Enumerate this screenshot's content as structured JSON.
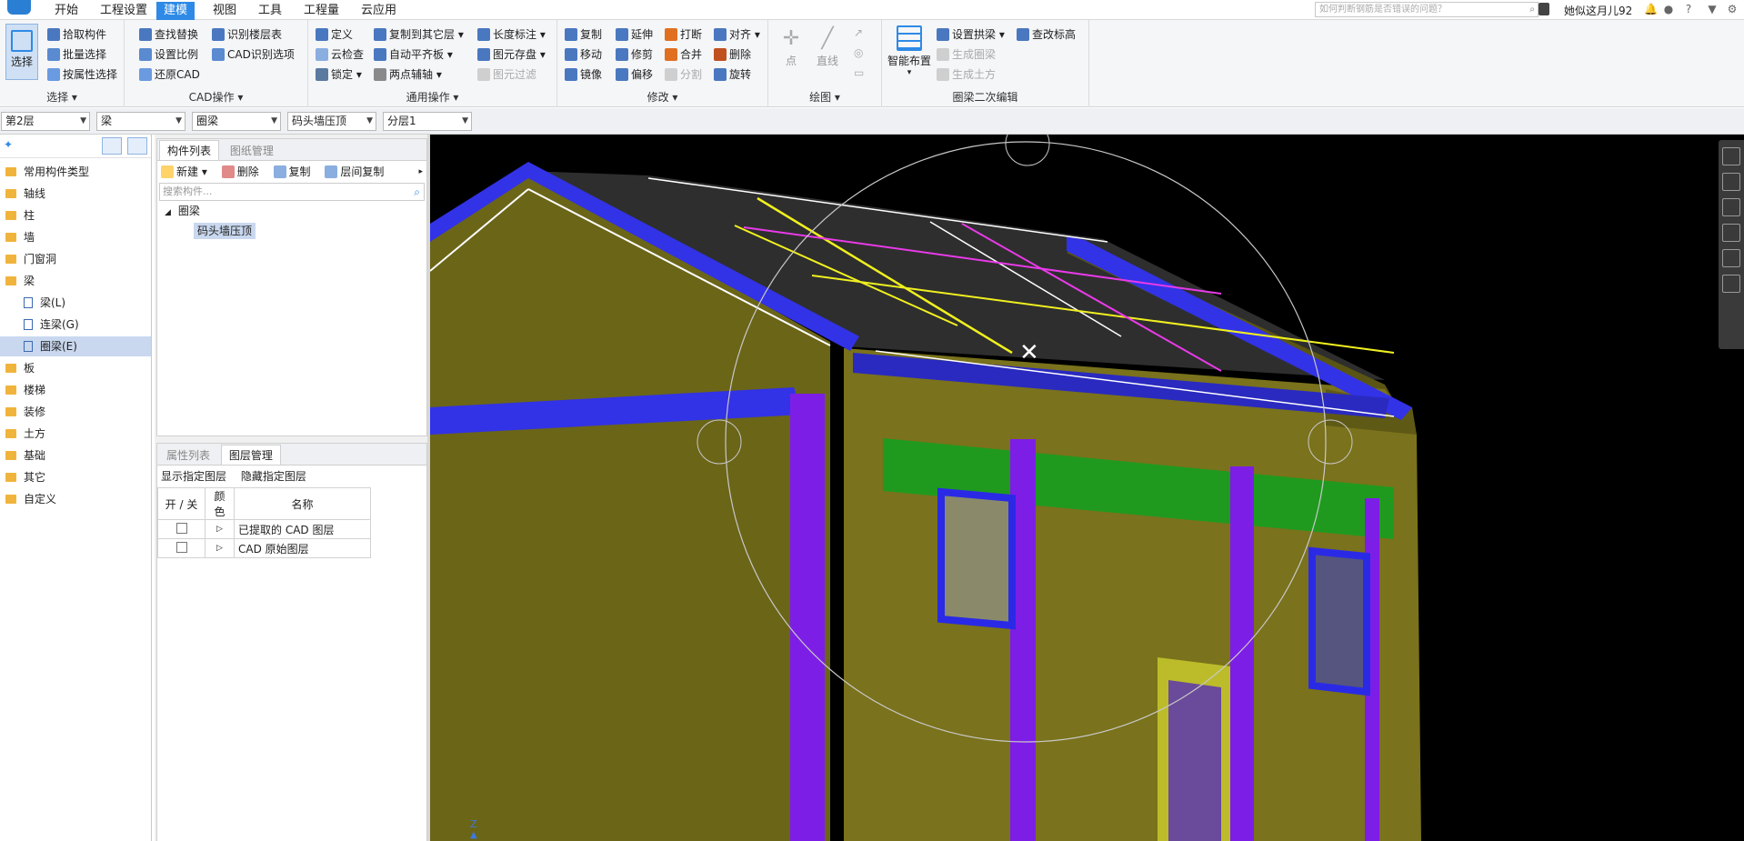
{
  "menubar": {
    "items": [
      "开始",
      "工程设置",
      "建模",
      "视图",
      "工具",
      "工程量",
      "云应用"
    ],
    "active": "建模",
    "search_placeholder": "如何判断钢筋是否错误的问题？",
    "user": "她似这月儿92"
  },
  "ribbon": {
    "select": {
      "title": "选择",
      "big_label": "选择",
      "items": [
        "拾取构件",
        "批量选择",
        "按属性选择"
      ]
    },
    "cad": {
      "title": "CAD操作",
      "items": [
        "查找替换",
        "识别楼层表",
        "设置比例",
        "CAD识别选项",
        "还原CAD"
      ]
    },
    "common": {
      "title": "通用操作",
      "items": [
        "定义",
        "复制到其它层",
        "长度标注",
        "云检查",
        "自动平齐板",
        "图元存盘",
        "锁定",
        "两点辅轴",
        "图元过滤"
      ]
    },
    "modify": {
      "title": "修改",
      "items": [
        "复制",
        "延伸",
        "打断",
        "对齐",
        "移动",
        "修剪",
        "合并",
        "删除",
        "镜像",
        "偏移",
        "分割",
        "旋转"
      ]
    },
    "draw": {
      "title": "绘图",
      "items": [
        "点",
        "直线"
      ]
    },
    "ring": {
      "title": "圈梁二次编辑",
      "big_label": "智能布置",
      "items": [
        "设置拱梁",
        "查改标高",
        "生成圈梁",
        "生成土方"
      ]
    }
  },
  "dropdowns": [
    "第2层",
    "梁",
    "圈梁",
    "码头墙压顶",
    "分层1"
  ],
  "tree": {
    "items": [
      {
        "label": "常用构件类型",
        "type": "folder"
      },
      {
        "label": "轴线",
        "type": "folder"
      },
      {
        "label": "柱",
        "type": "folder"
      },
      {
        "label": "墙",
        "type": "folder"
      },
      {
        "label": "门窗洞",
        "type": "folder"
      },
      {
        "label": "梁",
        "type": "folder-open"
      },
      {
        "label": "梁(L)",
        "type": "child"
      },
      {
        "label": "连梁(G)",
        "type": "child"
      },
      {
        "label": "圈梁(E)",
        "type": "child-selected"
      },
      {
        "label": "板",
        "type": "folder"
      },
      {
        "label": "楼梯",
        "type": "folder"
      },
      {
        "label": "装修",
        "type": "folder"
      },
      {
        "label": "土方",
        "type": "folder"
      },
      {
        "label": "基础",
        "type": "folder"
      },
      {
        "label": "其它",
        "type": "folder"
      },
      {
        "label": "自定义",
        "type": "folder"
      }
    ]
  },
  "component_panel": {
    "tabs": [
      "构件列表",
      "图纸管理"
    ],
    "toolbar": [
      "新建",
      "删除",
      "复制",
      "层间复制"
    ],
    "search_placeholder": "搜索构件...",
    "group": "圈梁",
    "item": "码头墙压顶"
  },
  "layer_panel": {
    "tabs": [
      "属性列表",
      "图层管理"
    ],
    "actions": [
      "显示指定图层",
      "隐藏指定图层"
    ],
    "headers": [
      "开 / 关",
      "颜色",
      "名称"
    ],
    "rows": [
      {
        "name": "已提取的 CAD 图层"
      },
      {
        "name": "CAD 原始图层"
      }
    ]
  },
  "viewport": {
    "axis_label": "Z"
  },
  "colors": {
    "accent": "#2e8ae6",
    "wall": "#6b6518",
    "roof": "#2e2e2e",
    "eave": "#3232e6",
    "column": "#7d1ee6",
    "beam": "#1f9a1f"
  }
}
